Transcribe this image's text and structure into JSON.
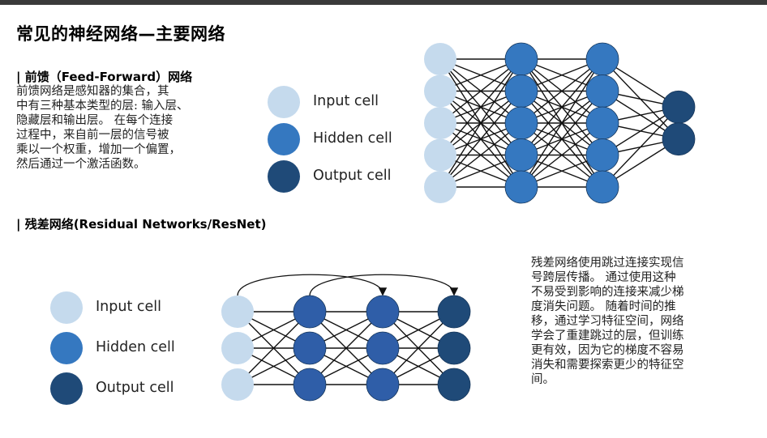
{
  "page": {
    "title": "常见的神经网络—主要网络"
  },
  "feedforward": {
    "heading": "| 前馈（Feed-Forward）网络",
    "paragraph_lines": [
      "前馈网络是感知器的集合，其",
      "中有三种基本类型的层: 输入层、",
      "隐藏层和输出层。 在每个连接",
      "过程中，来自前一层的信号被",
      "乘以一个权重，增加一个偏置，",
      "然后通过一个激活函数。"
    ],
    "legend": [
      {
        "label": "Input cell",
        "color": "#c5daed"
      },
      {
        "label": "Hidden cell",
        "color": "#3578c0"
      },
      {
        "label": "Output cell",
        "color": "#1f4a78"
      }
    ],
    "layers": [
      {
        "role": "input",
        "count": 5,
        "color": "#c5daed"
      },
      {
        "role": "hidden",
        "count": 5,
        "color": "#3578c0"
      },
      {
        "role": "hidden",
        "count": 5,
        "color": "#3578c0"
      },
      {
        "role": "output",
        "count": 2,
        "color": "#1f4a78"
      }
    ]
  },
  "resnet": {
    "heading": "| 残差网络(Residual Networks/ResNet)",
    "paragraph_lines": [
      "残差网络使用跳过连接实现信",
      "号跨层传播。 通过使用这种",
      "不易受到影响的连接来减少梯",
      "度消失问题。 随着时间的推",
      "移，通过学习特征空间，网络",
      "学会了重建跳过的层，但训练",
      "更有效，因为它的梯度不容易",
      "消失和需要探索更少的特征空",
      "间。"
    ],
    "legend": [
      {
        "label": "Input cell",
        "color": "#c5daed"
      },
      {
        "label": "Hidden cell",
        "color": "#3578c0"
      },
      {
        "label": "Output cell",
        "color": "#1f4a78"
      }
    ],
    "layers": [
      {
        "role": "input",
        "count": 3,
        "color": "#c5daed"
      },
      {
        "role": "hidden",
        "count": 3,
        "color": "#2f5ea8"
      },
      {
        "role": "hidden",
        "count": 3,
        "color": "#2f5ea8"
      },
      {
        "role": "output",
        "count": 3,
        "color": "#1f4a78"
      }
    ]
  }
}
